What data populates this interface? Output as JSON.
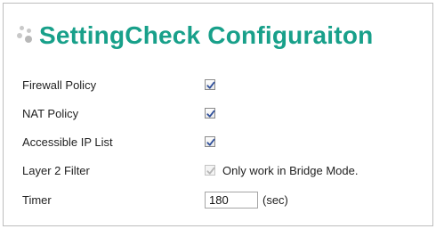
{
  "title": "SettingCheck Configuraiton",
  "rows": [
    {
      "label": "Firewall Policy",
      "checked": true,
      "enabled": true
    },
    {
      "label": "NAT Policy",
      "checked": true,
      "enabled": true
    },
    {
      "label": "Accessible IP List",
      "checked": true,
      "enabled": true
    },
    {
      "label": "Layer 2 Filter",
      "checked": true,
      "enabled": false,
      "note": "Only work in Bridge Mode."
    }
  ],
  "timer": {
    "label": "Timer",
    "value": "180",
    "unit": "(sec)"
  },
  "colors": {
    "title": "#18a08a",
    "checkmark": "#2f4f9a",
    "checkmark_disabled": "#b5b5b5"
  },
  "icons": {
    "title_decoration": "dots-icon",
    "checkbox": "checkmark-icon"
  }
}
